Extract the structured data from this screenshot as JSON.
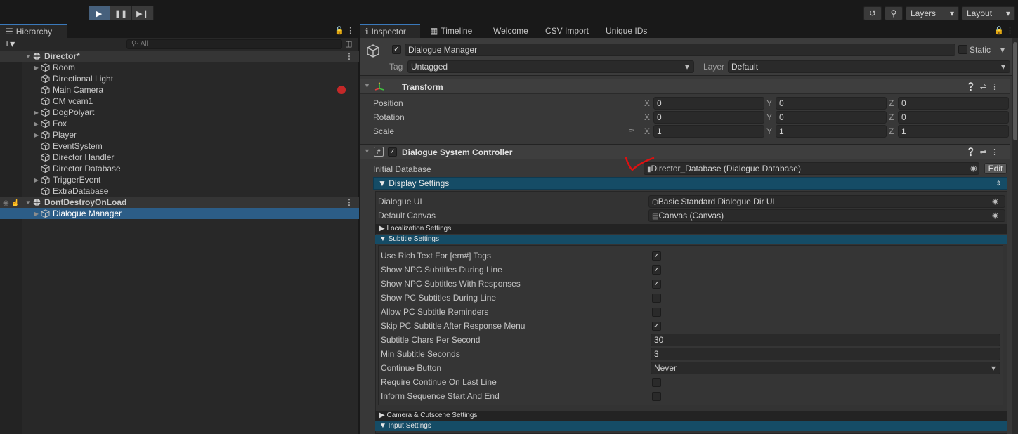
{
  "toolbar": {
    "layers_label": "Layers",
    "layout_label": "Layout"
  },
  "hierarchy": {
    "tab_label": "Hierarchy",
    "search_placeholder": "All",
    "items": [
      {
        "label": "Director*",
        "depth": 0,
        "scene": true,
        "expanded": true,
        "selected": false
      },
      {
        "label": "Room",
        "depth": 1,
        "has_children": true
      },
      {
        "label": "Directional Light",
        "depth": 1,
        "has_children": false
      },
      {
        "label": "Main Camera",
        "depth": 1,
        "has_children": false
      },
      {
        "label": "CM vcam1",
        "depth": 1,
        "has_children": false
      },
      {
        "label": "DogPolyart",
        "depth": 1,
        "has_children": true
      },
      {
        "label": "Fox",
        "depth": 1,
        "has_children": true
      },
      {
        "label": "Player",
        "depth": 1,
        "has_children": true
      },
      {
        "label": "EventSystem",
        "depth": 1,
        "has_children": false
      },
      {
        "label": "Director Handler",
        "depth": 1,
        "has_children": false
      },
      {
        "label": "Director Database",
        "depth": 1,
        "has_children": false
      },
      {
        "label": "TriggerEvent",
        "depth": 1,
        "has_children": true
      },
      {
        "label": "ExtraDatabase",
        "depth": 1,
        "has_children": false
      },
      {
        "label": "DontDestroyOnLoad",
        "depth": 0,
        "scene": true,
        "expanded": true
      },
      {
        "label": "Dialogue Manager",
        "depth": 1,
        "has_children": true,
        "selected": true
      }
    ]
  },
  "inspector": {
    "tabs": [
      "Inspector",
      "Timeline",
      "Welcome",
      "CSV Import",
      "Unique IDs"
    ],
    "object_name": "Dialogue Manager",
    "static_label": "Static",
    "tag_label": "Tag",
    "tag_value": "Untagged",
    "layer_label": "Layer",
    "layer_value": "Default",
    "transform": {
      "title": "Transform",
      "position_label": "Position",
      "rotation_label": "Rotation",
      "scale_label": "Scale",
      "position": [
        "0",
        "0",
        "0"
      ],
      "rotation": [
        "0",
        "0",
        "0"
      ],
      "scale": [
        "1",
        "1",
        "1"
      ],
      "axis_labels": [
        "X",
        "Y",
        "Z"
      ]
    },
    "controller": {
      "title": "Dialogue System Controller",
      "initial_db_label": "Initial Database",
      "initial_db_value": "Director_Database (Dialogue Database)",
      "edit_label": "Edit",
      "display_settings_label": "▼ Display Settings",
      "dialogue_ui_label": "Dialogue UI",
      "dialogue_ui_value": "Basic Standard Dialogue Dir UI",
      "default_canvas_label": "Default Canvas",
      "default_canvas_value": "Canvas (Canvas)",
      "localization_label": "▶ Localization Settings",
      "subtitle_label": "▼ Subtitle Settings",
      "camera_label": "▶ Camera & Cutscene Settings",
      "input_label": "▼ Input Settings",
      "subtitle_rows": [
        {
          "label": "Use Rich Text For [em#] Tags",
          "type": "check",
          "checked": true
        },
        {
          "label": "Show NPC Subtitles During Line",
          "type": "check",
          "checked": true
        },
        {
          "label": "Show NPC Subtitles With Responses",
          "type": "check",
          "checked": true
        },
        {
          "label": "Show PC Subtitles During Line",
          "type": "check",
          "checked": false
        },
        {
          "label": "Allow PC Subtitle Reminders",
          "type": "check",
          "checked": false
        },
        {
          "label": "Skip PC Subtitle After Response Menu",
          "type": "check",
          "checked": true
        },
        {
          "label": "Subtitle Chars Per Second",
          "type": "text",
          "value": "30"
        },
        {
          "label": "Min Subtitle Seconds",
          "type": "text",
          "value": "3"
        },
        {
          "label": "Continue Button",
          "type": "dropdown",
          "value": "Never"
        },
        {
          "label": "Require Continue On Last Line",
          "type": "check",
          "checked": false
        },
        {
          "label": "Inform Sequence Start And End",
          "type": "check",
          "checked": false
        }
      ]
    }
  },
  "colors": {
    "accent_blue": "#2c5d87",
    "foldout_blue": "#154c66",
    "annotation_red": "#e01010"
  }
}
